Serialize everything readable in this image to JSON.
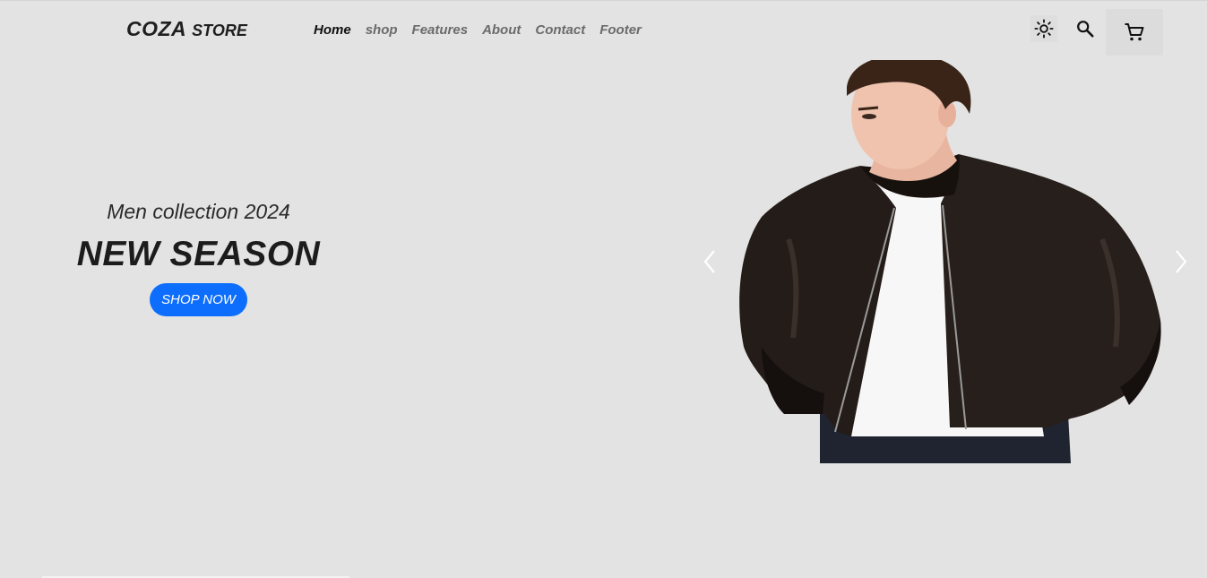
{
  "header": {
    "logo_brand": "COZA",
    "logo_sub": "STORE",
    "nav": [
      {
        "label": "Home",
        "active": true
      },
      {
        "label": "shop",
        "active": false
      },
      {
        "label": "Features",
        "active": false
      },
      {
        "label": "About",
        "active": false
      },
      {
        "label": "Contact",
        "active": false
      },
      {
        "label": "Footer",
        "active": false
      }
    ],
    "icons": [
      "sun-icon",
      "search-icon",
      "cart-icon"
    ]
  },
  "hero": {
    "subtitle": "Men collection 2024",
    "title": "NEW SEASON",
    "cta_label": "SHOP NOW"
  },
  "carousel": {
    "prev_icon": "chevron-left-icon",
    "next_icon": "chevron-right-icon"
  },
  "colors": {
    "background": "#e3e3e3",
    "cta": "#0d6efd",
    "nav_active": "#111111",
    "nav_inactive": "#6b6b6b"
  }
}
